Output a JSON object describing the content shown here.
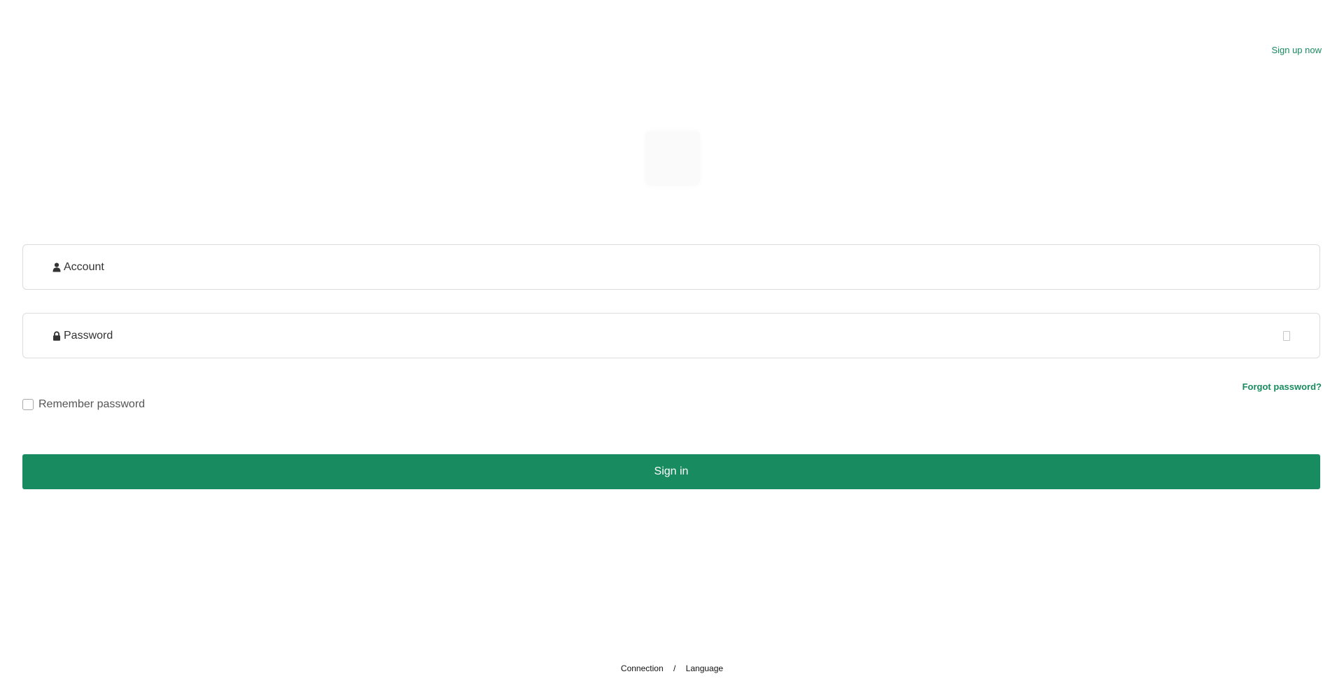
{
  "header": {
    "signup_label": "Sign up now"
  },
  "form": {
    "account_placeholder": "Account",
    "password_placeholder": "Password",
    "forgot_label": "Forgot password?",
    "remember_label": "Remember password",
    "remember_checked": false,
    "signin_label": "Sign in"
  },
  "footer": {
    "connection_label": "Connection",
    "separator": "/",
    "language_label": "Language"
  },
  "colors": {
    "accent": "#188b60",
    "field_border": "#dcdcdc"
  },
  "icons": {
    "account": "user-icon",
    "password": "lock-icon",
    "toggle": "eye-icon"
  }
}
